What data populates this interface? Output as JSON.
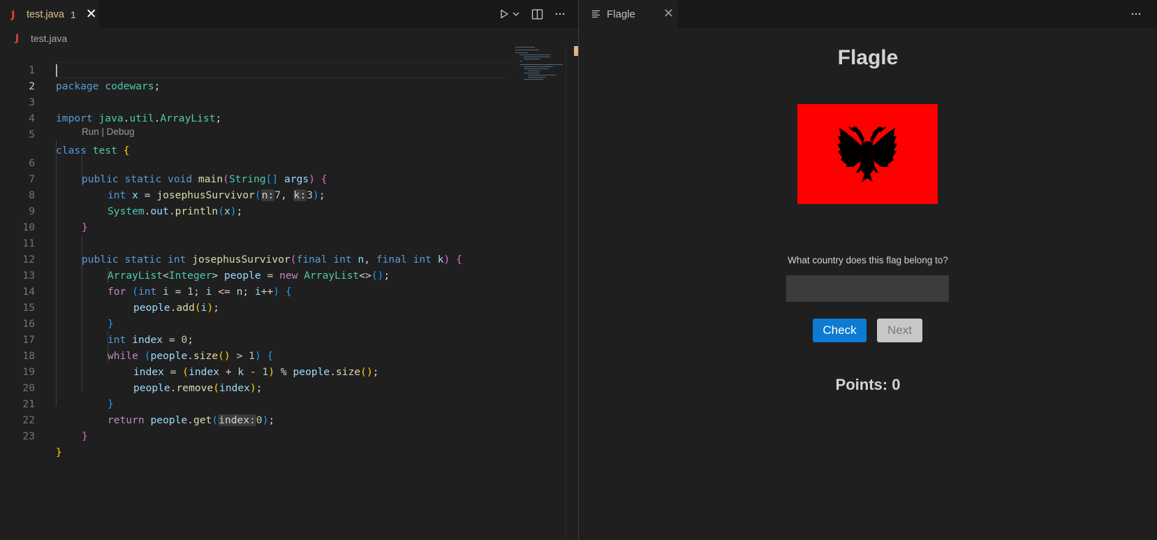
{
  "editor": {
    "tab": {
      "title": "test.java",
      "problem_count": "1",
      "close_glyph": "✕",
      "icon": "java-icon"
    },
    "actions": {
      "run": "play-icon",
      "run_menu": "chevron-down-icon",
      "split": "split-editor-icon",
      "more": "ellipsis-icon"
    },
    "breadcrumb": {
      "file": "test.java"
    },
    "codelens": "Run | Debug",
    "line_numbers": [
      "1",
      "2",
      "3",
      "4",
      "5",
      "6",
      "7",
      "8",
      "9",
      "10",
      "11",
      "12",
      "13",
      "14",
      "15",
      "16",
      "17",
      "18",
      "19",
      "20",
      "21",
      "22",
      "23"
    ],
    "active_line": "2",
    "code": {
      "l1_pkg": "package",
      "l1_name": "codewars",
      "l1_semi": ";",
      "l3_import": "import",
      "l3_p1": "java",
      "l3_p2": "util",
      "l3_cls": "ArrayList",
      "l3_semi": ";",
      "l5_class": "class",
      "l5_name": "test",
      "l5_brace": "{",
      "l6_public": "public",
      "l6_static": "static",
      "l6_void": "void",
      "l6_main": "main",
      "l6_lp": "(",
      "l6_string": "String",
      "l6_arr": "[]",
      "l6_args": "args",
      "l6_rp": ")",
      "l6_brace": "{",
      "l7_int": "int",
      "l7_x": "x",
      "l7_eq": " = ",
      "l7_fn": "josephusSurvivor",
      "l7_lp": "(",
      "l7_hint_n": "n:",
      "l7_n": "7",
      "l7_comma": ", ",
      "l7_hint_k": "k:",
      "l7_k": "3",
      "l7_rp": ")",
      "l7_semi": ";",
      "l8_system": "System",
      "l8_out": "out",
      "l8_println": "println",
      "l8_lp": "(",
      "l8_x": "x",
      "l8_rp": ")",
      "l8_semi": ";",
      "l9_brace": "}",
      "l11_public": "public",
      "l11_static": "static",
      "l11_int": "int",
      "l11_fn": "josephusSurvivor",
      "l11_lp": "(",
      "l11_final1": "final",
      "l11_int1": "int",
      "l11_n": "n",
      "l11_comma": ", ",
      "l11_final2": "final",
      "l11_int2": "int",
      "l11_k": "k",
      "l11_rp": ")",
      "l11_brace": "{",
      "l12_list": "ArrayList",
      "l12_lt": "<",
      "l12_integer": "Integer",
      "l12_gt": ">",
      "l12_people": "people",
      "l12_eq": " = ",
      "l12_new": "new",
      "l12_list2": "ArrayList",
      "l12_diamond": "<>",
      "l12_paren": "()",
      "l12_semi": ";",
      "l13_for": "for",
      "l13_lp": "(",
      "l13_int": "int",
      "l13_i": "i",
      "l13_eq": " = ",
      "l13_one": "1",
      "l13_semi1": "; ",
      "l13_i2": "i",
      "l13_le": " <= ",
      "l13_n": "n",
      "l13_semi2": "; ",
      "l13_i3": "i",
      "l13_inc": "++",
      "l13_rp": ")",
      "l13_brace": "{",
      "l14_people": "people",
      "l14_add": "add",
      "l14_lp": "(",
      "l14_i": "i",
      "l14_rp": ")",
      "l14_semi": ";",
      "l15_brace": "}",
      "l16_int": "int",
      "l16_index": "index",
      "l16_eq": " = ",
      "l16_zero": "0",
      "l16_semi": ";",
      "l17_while": "while",
      "l17_lp": "(",
      "l17_people": "people",
      "l17_size": "size",
      "l17_paren": "()",
      "l17_gt": " > ",
      "l17_one": "1",
      "l17_rp": ")",
      "l17_brace": "{",
      "l18_index": "index",
      "l18_eq": " = ",
      "l18_lp": "(",
      "l18_index2": "index",
      "l18_plus": " + ",
      "l18_k": "k",
      "l18_minus": " - ",
      "l18_one": "1",
      "l18_rp": ")",
      "l18_mod": " % ",
      "l18_people": "people",
      "l18_size": "size",
      "l18_paren": "()",
      "l18_semi": ";",
      "l19_people": "people",
      "l19_remove": "remove",
      "l19_lp": "(",
      "l19_index": "index",
      "l19_rp": ")",
      "l19_semi": ";",
      "l20_brace": "}",
      "l21_return": "return",
      "l21_people": "people",
      "l21_get": "get",
      "l21_lp": "(",
      "l21_hint": "index:",
      "l21_zero": "0",
      "l21_rp": ")",
      "l21_semi": ";",
      "l22_brace": "}",
      "l23_brace": "}",
      "dot": ".",
      "sp": " "
    }
  },
  "webview": {
    "tab": {
      "title": "Flagle",
      "icon": "preview-icon",
      "close_glyph": "✕"
    },
    "more": "ellipsis-icon",
    "game": {
      "title": "Flagle",
      "flag_country": "Albania",
      "question": "What country does this flag belong to?",
      "answer_value": "",
      "check_label": "Check",
      "next_label": "Next",
      "points_label": "Points: 0"
    }
  },
  "colors": {
    "background": "#1f1f1f",
    "tabbar": "#181818",
    "accent_button": "#0e7bd2",
    "flag_red": "#ff0000",
    "flag_eagle": "#000000",
    "modified_tab": "#e2c08d",
    "java_icon": "#e0442f"
  }
}
